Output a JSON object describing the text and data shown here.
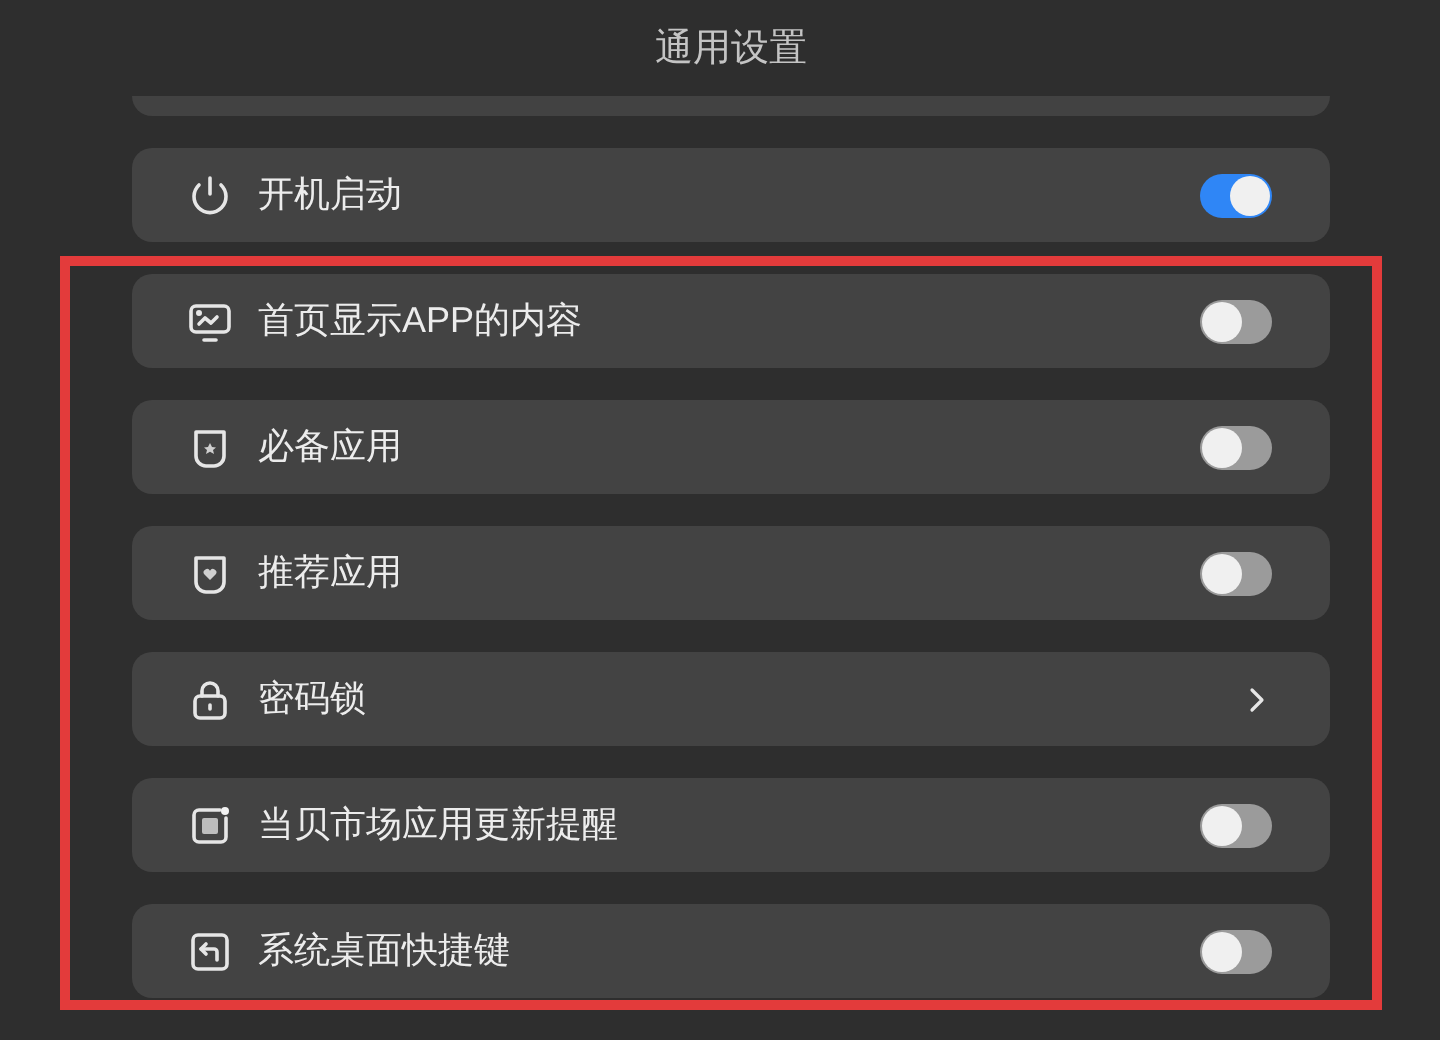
{
  "title": "通用设置",
  "rows": [
    {
      "kind": "toggle",
      "label": "开机启动",
      "on": true
    },
    {
      "kind": "toggle",
      "label": "首页显示APP的内容",
      "on": false
    },
    {
      "kind": "toggle",
      "label": "必备应用",
      "on": false
    },
    {
      "kind": "toggle",
      "label": "推荐应用",
      "on": false
    },
    {
      "kind": "link",
      "label": "密码锁"
    },
    {
      "kind": "toggle",
      "label": "当贝市场应用更新提醒",
      "on": false
    },
    {
      "kind": "toggle",
      "label": "系统桌面快捷键",
      "on": false
    }
  ]
}
